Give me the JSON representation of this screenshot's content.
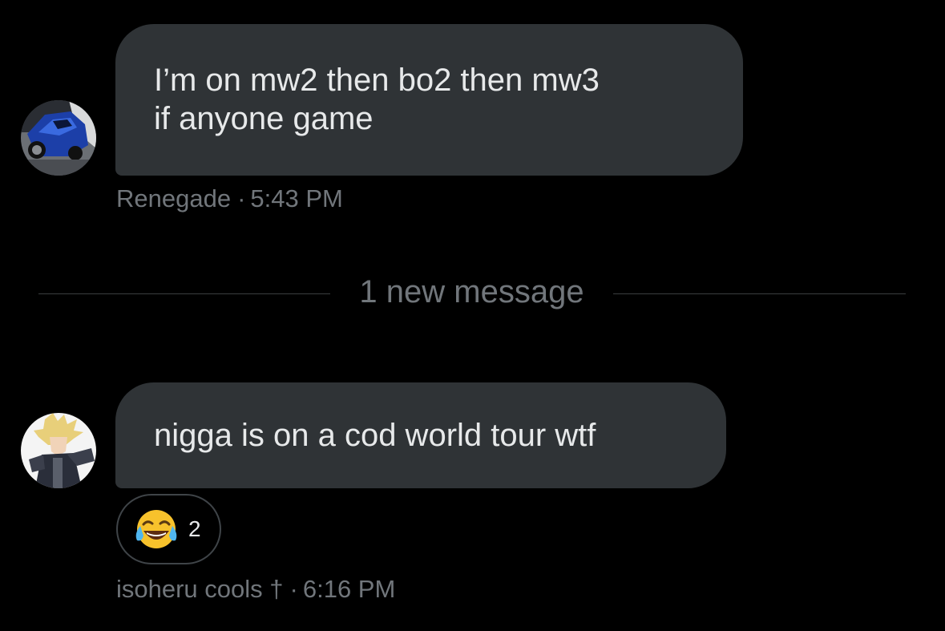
{
  "conversation": {
    "messages": [
      {
        "lines": [
          "I’m on mw2 then bo2 then mw3",
          "if anyone game"
        ],
        "sender": "Renegade",
        "separator": "·",
        "time": "5:43 PM",
        "avatar_icon": "car-avatar-icon"
      },
      {
        "lines": [
          "nigga is on a cod world tour wtf"
        ],
        "sender": "isoheru cools †",
        "separator": "·",
        "time": "6:16 PM",
        "avatar_icon": "anime-character-avatar-icon",
        "reaction": {
          "emoji_icon": "face-with-tears-of-joy-icon",
          "count": "2"
        }
      }
    ],
    "new_message_divider": "1 new message"
  },
  "colors": {
    "background": "#000000",
    "bubble": "#2f3336",
    "text_primary": "#e7e9ea",
    "text_secondary": "#71767b"
  }
}
